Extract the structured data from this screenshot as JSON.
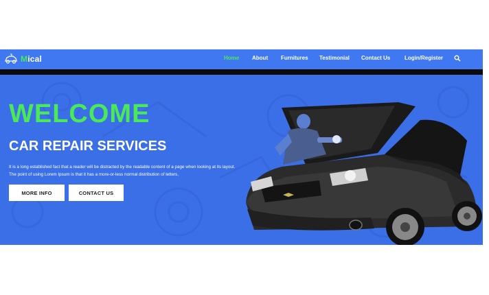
{
  "brand": {
    "first_letter": "M",
    "rest": "ical"
  },
  "nav": {
    "items": [
      {
        "label": "Home",
        "active": true
      },
      {
        "label": "About",
        "active": false
      },
      {
        "label": "Furnitures",
        "active": false
      },
      {
        "label": "Testimonial",
        "active": false
      },
      {
        "label": "Contact Us",
        "active": false
      },
      {
        "label": "Login/Register",
        "active": false
      }
    ],
    "search_icon": "search-icon"
  },
  "hero": {
    "headline": "WELCOME",
    "subtitle": "CAR REPAIR SERVICES",
    "description": "It is a long established fact that a reader will be distracted by the readable content of a page when looking at its layout. The point of using Lorem Ipsum is that it has a more-or-less normal distribution of letters,",
    "buttons": {
      "more_info": "MORE INFO",
      "contact_us": "CONTACT US"
    }
  },
  "colors": {
    "navbar": "#3f78f0",
    "hero_background": "#3b6fe8",
    "accent_green": "#4be85a",
    "button_background": "#ffffff",
    "dark_strip": "#0b0b0b"
  }
}
